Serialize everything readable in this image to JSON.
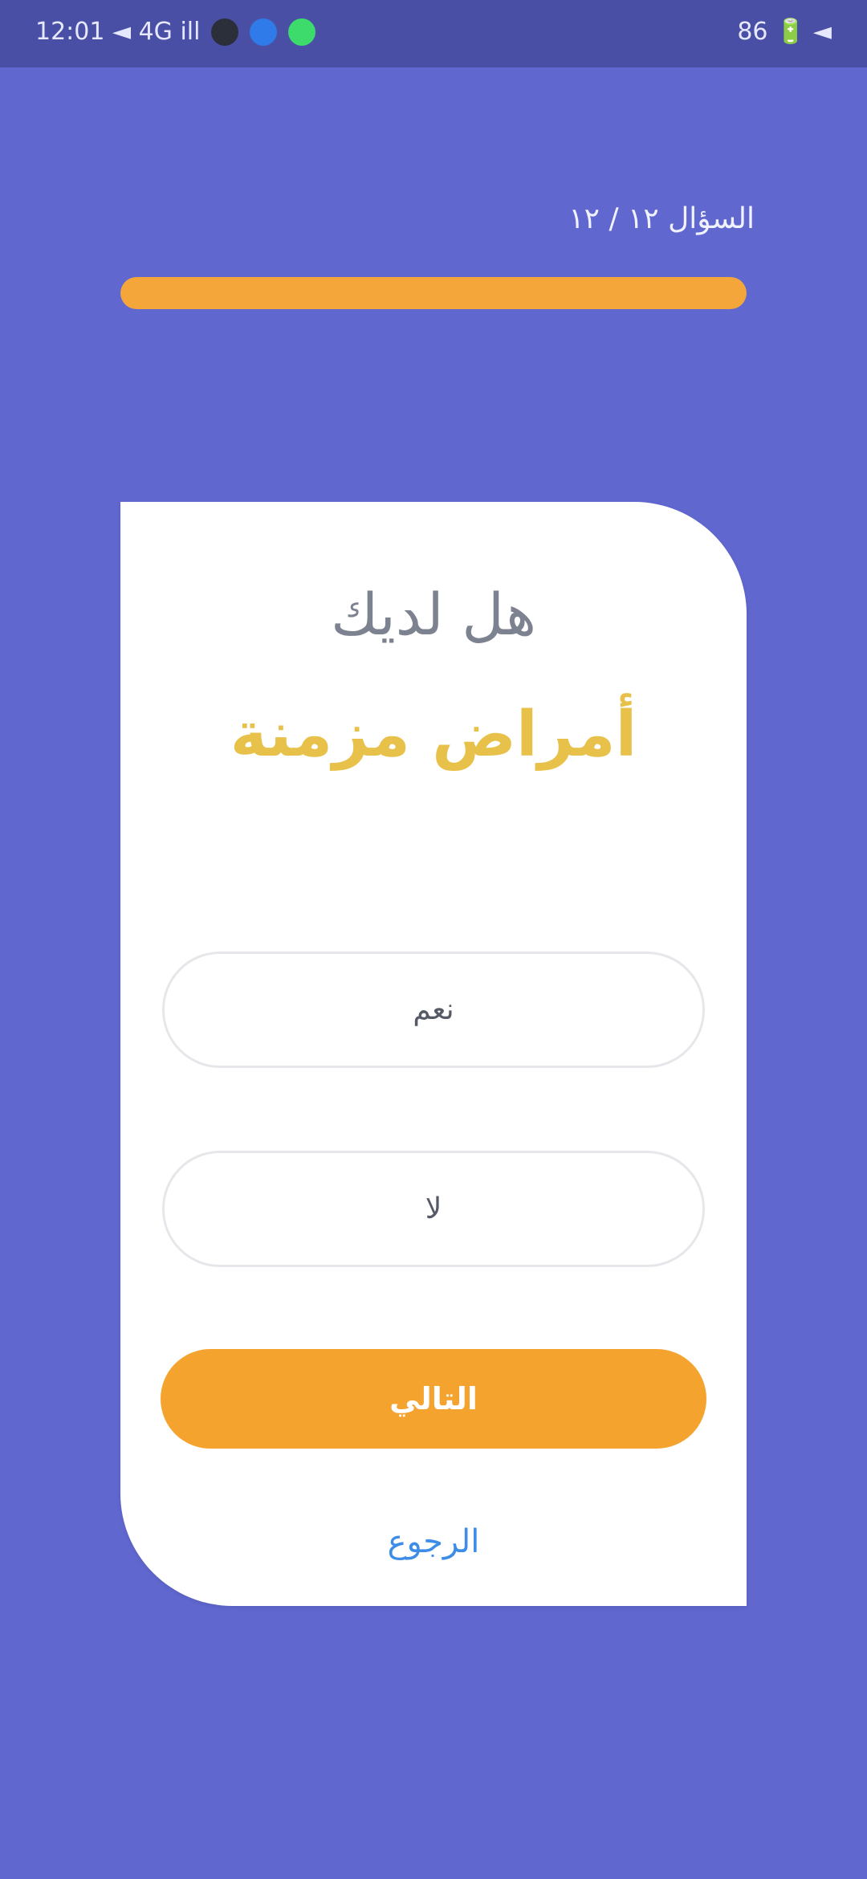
{
  "status_bar": {
    "left_text": "12:01 ◄ 4G ill",
    "right_text": "86 🔋 ◄"
  },
  "step": {
    "label": "السؤال ١٢ / ١٢",
    "progress_fraction": 1.0
  },
  "question": {
    "line1": "هل لديك",
    "line2": "أمراض مزمنة"
  },
  "options": [
    {
      "label": "نعم"
    },
    {
      "label": "لا"
    }
  ],
  "actions": {
    "submit_label": "التالي",
    "back_label": "الرجوع"
  },
  "colors": {
    "background": "#6067CF",
    "accent_orange": "#F5A32F",
    "title_yellow": "#E8C14A",
    "link_blue": "#3C8CE8"
  }
}
